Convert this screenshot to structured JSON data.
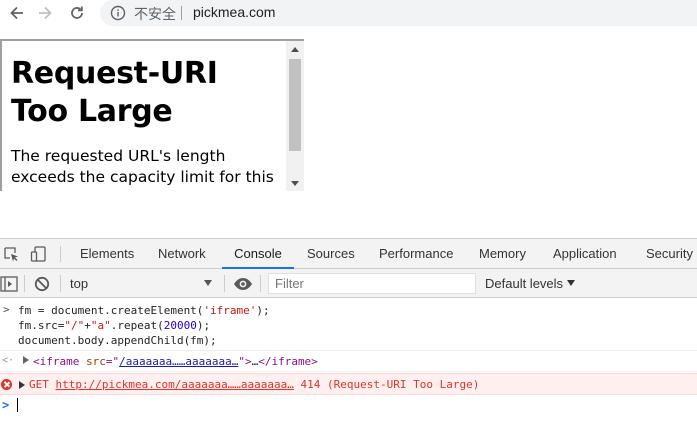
{
  "browser": {
    "insecure_label": "不安全",
    "url": "pickmea.com"
  },
  "page": {
    "heading": "Request-URI Too Large",
    "body": "The requested URL's length exceeds the capacity limit for this"
  },
  "devtools": {
    "tabs": [
      "Elements",
      "Network",
      "Console",
      "Sources",
      "Performance",
      "Memory",
      "Application",
      "Security"
    ],
    "active_tab": "Console",
    "accent_color": "#1a73e8",
    "context": "top",
    "filter_placeholder": "Filter",
    "levels": "Default levels"
  },
  "console": {
    "input_lines": [
      "fm = document.createElement('iframe');",
      "fm.src=\"/\"+\"a\".repeat(20000);",
      "document.body.appendChild(fm);"
    ],
    "result": {
      "tag_open": "<iframe",
      "attr_name": "src",
      "attr_value": "/aaaaaaa……aaaaaaa…",
      "collapsed": "…",
      "tag_close": "</iframe>"
    },
    "error": {
      "method": "GET",
      "url": "http://pickmea.com/aaaaaaa……aaaaaaa…",
      "status": "414 (Request-URI Too Large)",
      "color": "#e0312b"
    }
  }
}
